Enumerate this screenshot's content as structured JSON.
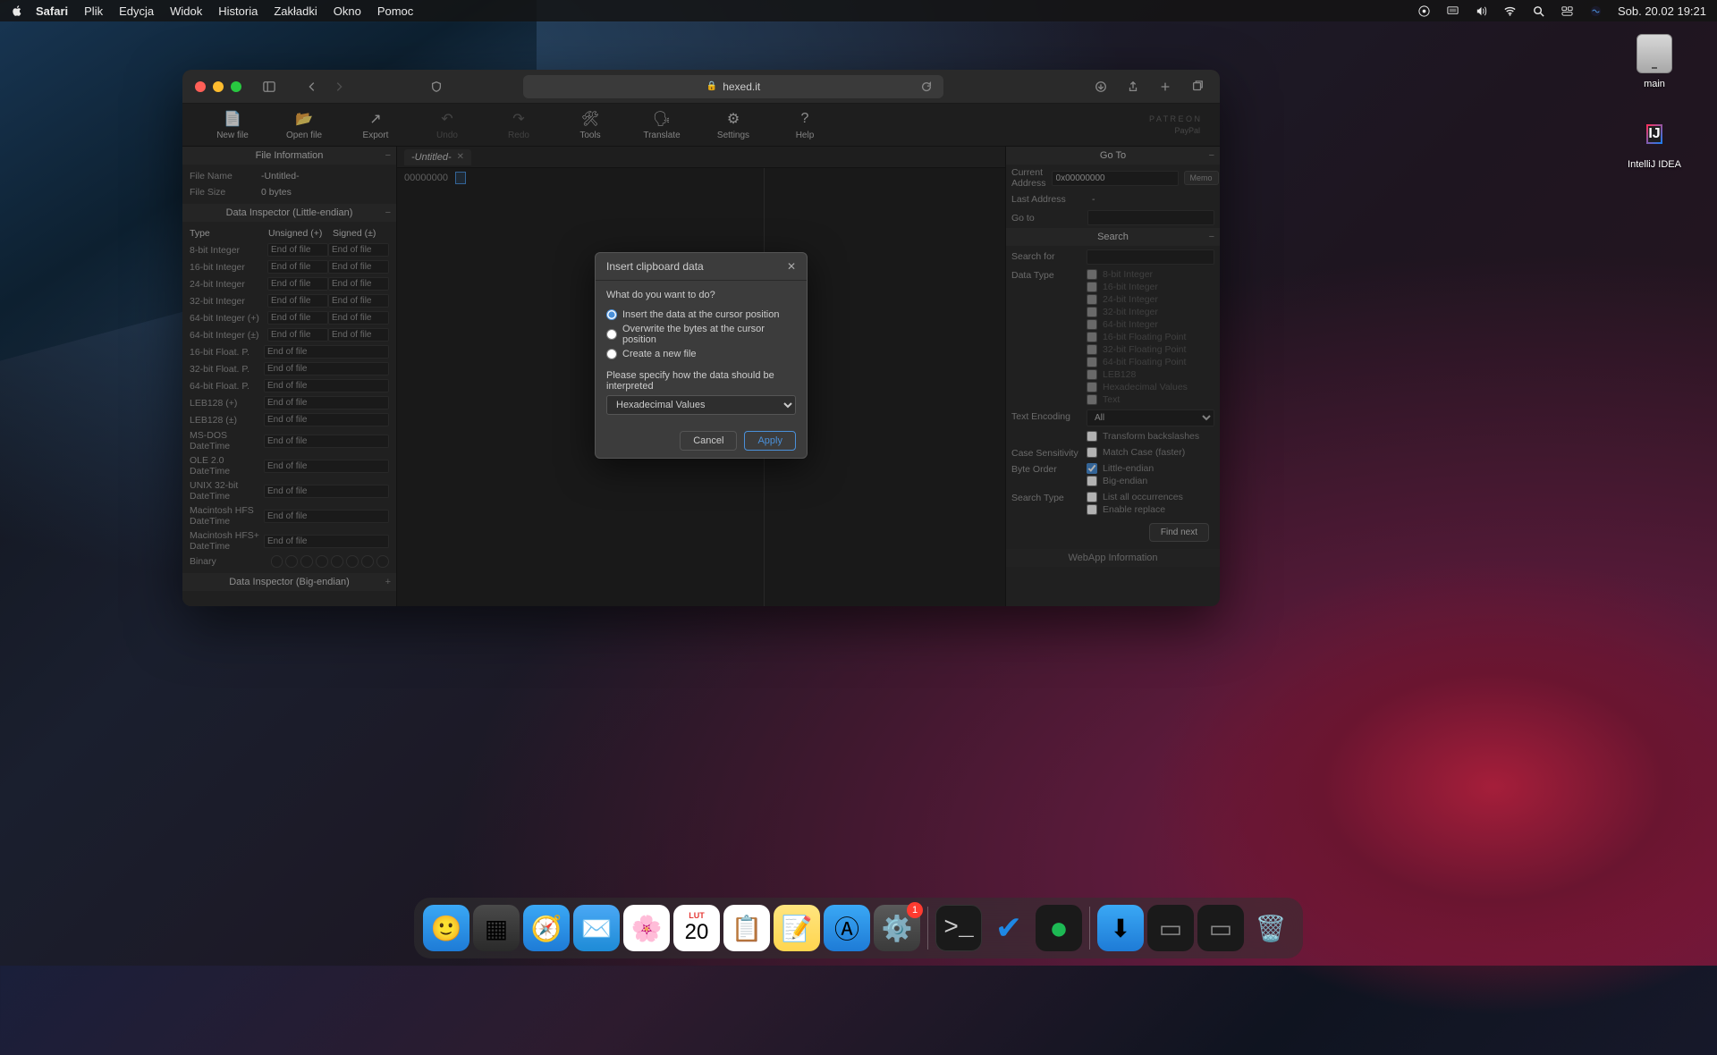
{
  "menubar": {
    "app": "Safari",
    "items": [
      "Plik",
      "Edycja",
      "Widok",
      "Historia",
      "Zakładki",
      "Okno",
      "Pomoc"
    ],
    "clock": "Sob. 20.02  19:21"
  },
  "desktop": {
    "hdd_label": "main",
    "ij_label": "IntelliJ IDEA",
    "ij_text": "IJ"
  },
  "safari": {
    "url": "hexed.it"
  },
  "app": {
    "toolbar": {
      "new_file": "New file",
      "open_file": "Open file",
      "export": "Export",
      "undo": "Undo",
      "redo": "Redo",
      "tools": "Tools",
      "translate": "Translate",
      "settings": "Settings",
      "help": "Help",
      "patreon": "P A T R E O N",
      "paypal": "PayPal"
    },
    "tab": "-Untitled-",
    "hex": {
      "offset": "00000000"
    },
    "left": {
      "file_info_header": "File Information",
      "file_name_label": "File Name",
      "file_name_value": "-Untitled-",
      "file_size_label": "File Size",
      "file_size_value": "0 bytes",
      "di_le_header": "Data Inspector (Little-endian)",
      "di_be_header": "Data Inspector (Big-endian)",
      "col_type": "Type",
      "col_unsigned": "Unsigned (+)",
      "col_signed": "Signed (±)",
      "eof": "End of file",
      "types_2col": [
        "8-bit Integer",
        "16-bit Integer",
        "24-bit Integer",
        "32-bit Integer",
        "64-bit Integer (+)",
        "64-bit Integer (±)"
      ],
      "types_1col": [
        "16-bit Float. P.",
        "32-bit Float. P.",
        "64-bit Float. P.",
        "LEB128 (+)",
        "LEB128 (±)",
        "MS-DOS DateTime",
        "OLE 2.0 DateTime",
        "UNIX 32-bit DateTime",
        "Macintosh HFS DateTime",
        "Macintosh HFS+ DateTime"
      ],
      "binary_label": "Binary"
    },
    "right": {
      "goto_header": "Go To",
      "cur_addr_label": "Current Address",
      "cur_addr_value": "0x00000000",
      "last_addr_label": "Last Address",
      "last_addr_value": "-",
      "goto_label": "Go to",
      "memo_btn": "Memo",
      "search_header": "Search",
      "search_for_label": "Search for",
      "data_type_label": "Data Type",
      "data_types": [
        "8-bit Integer",
        "16-bit Integer",
        "24-bit Integer",
        "32-bit Integer",
        "64-bit Integer",
        "16-bit Floating Point",
        "32-bit Floating Point",
        "64-bit Floating Point",
        "LEB128",
        "Hexadecimal Values",
        "Text"
      ],
      "text_enc_label": "Text Encoding",
      "text_enc_value": "All",
      "transform_label": "Transform backslashes",
      "case_label": "Case Sensitivity",
      "case_value": "Match Case (faster)",
      "byte_order_label": "Byte Order",
      "le_label": "Little-endian",
      "be_label": "Big-endian",
      "search_type_label": "Search Type",
      "list_all_label": "List all occurrences",
      "enable_replace_label": "Enable replace",
      "find_next": "Find next",
      "webapp_header": "WebApp Information"
    },
    "modal": {
      "title": "Insert clipboard data",
      "question": "What do you want to do?",
      "opt1": "Insert the data at the cursor position",
      "opt2": "Overwrite the bytes at the cursor position",
      "opt3": "Create a new file",
      "sub": "Please specify how the data should be interpreted",
      "select_value": "Hexadecimal Values",
      "cancel": "Cancel",
      "apply": "Apply"
    }
  },
  "dock": {
    "cal_month": "LUT",
    "cal_day": "20",
    "settings_badge": "1"
  }
}
